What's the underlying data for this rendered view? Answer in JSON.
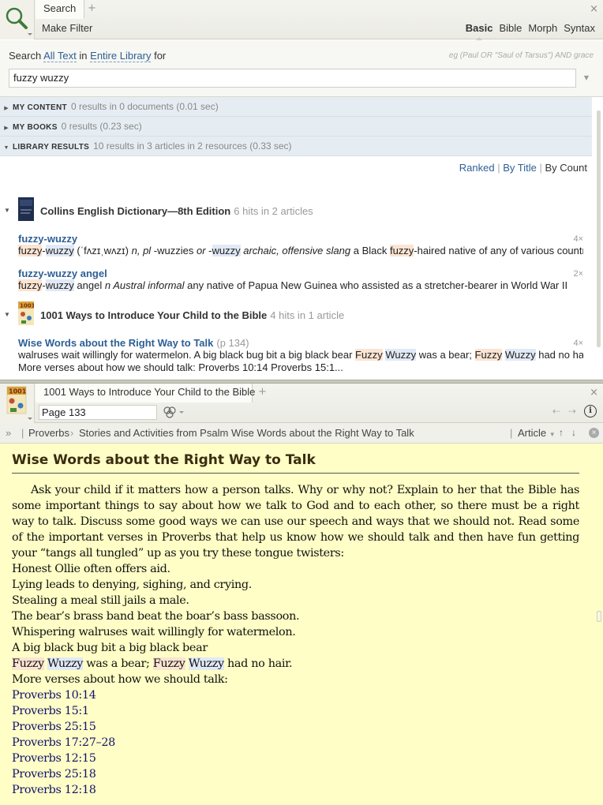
{
  "search_panel": {
    "tab_label": "Search",
    "make_filter": "Make Filter",
    "modes": [
      "Basic",
      "Bible",
      "Morph",
      "Syntax"
    ],
    "active_mode": "Basic",
    "search_line": {
      "prefix": "Search",
      "scope": "All Text",
      "in": "in",
      "library": "Entire Library",
      "suffix": "for"
    },
    "example": "eg (Paul OR \"Saul of Tarsus\") AND grace",
    "query": "fuzzy wuzzy",
    "sections": [
      {
        "name": "MY CONTENT",
        "summary": "0 results in 0 documents (0.01 sec)"
      },
      {
        "name": "MY BOOKS",
        "summary": "0 results (0.23 sec)"
      },
      {
        "name": "LIBRARY RESULTS",
        "summary": "10 results in 3 articles in 2 resources (0.33 sec)"
      }
    ],
    "sort": {
      "ranked": "Ranked",
      "sep": "|",
      "by_title": "By Title",
      "by_count": "By Count"
    },
    "resources": [
      {
        "title": "Collins English Dictionary—8th Edition",
        "hits": "6 hits in 2 articles",
        "cover_text": "Collins English Dictionary",
        "results": [
          {
            "title": "fuzzy-wuzzy",
            "count": "4×"
          },
          {
            "title": "fuzzy-wuzzy angel",
            "count": "2×"
          }
        ]
      },
      {
        "title": "1001 Ways to Introduce Your Child to the Bible",
        "hits": "4 hits in 1 article",
        "cover_text": "1001",
        "results": [
          {
            "title": "Wise Words about the Right Way to Talk",
            "page": "(p 134)",
            "count": "4×"
          }
        ]
      }
    ],
    "snippets": {
      "s1": {
        "w1": "fuzzy",
        "d1": "-",
        "w2": "wuzzy",
        "p1": " (ˈfʌzɪˌwʌzɪ) ",
        "p2": "n, pl",
        "p3": " -wuzzies ",
        "p4": "or",
        "p5": " -",
        "w3": "wuzzy",
        "p6": " ",
        "p7": "archaic, offensive slang",
        "p8": " a Black ",
        "w4": "fuzzy",
        "p9": "-haired native of any of various countries"
      },
      "s2": {
        "w1": "fuzzy",
        "d1": "-",
        "w2": "wuzzy",
        "p1": " angel ",
        "p2": "n Austral informal",
        "p3": " any native of Papua New Guinea who assisted as a stretcher-bearer in World War II"
      },
      "s3": {
        "p1": "walruses wait willingly for watermelon. A big black bug bit a big black bear ",
        "w1": "Fuzzy",
        "sp": " ",
        "w2": "Wuzzy",
        "p2": " was a bear; ",
        "w3": "Fuzzy",
        "sp2": " ",
        "w4": "Wuzzy",
        "p3": " had no hair.",
        "line2": "More verses about how we should talk: Proverbs 10:14 Proverbs 15:1..."
      }
    }
  },
  "book_panel": {
    "tab_label": "1001 Ways to Introduce Your Child to the Bible",
    "page": "Page 133",
    "breadcrumbs": [
      "Proverbs",
      "Stories and Activities from Psalm",
      "Wise Words about the Right Way to Talk"
    ],
    "article_menu": "Article",
    "article": {
      "title": "Wise Words about the Right Way to Talk",
      "paragraph": "Ask your child if it matters how a person talks. Why or why not? Explain to her that the Bible has some important things to say about how we talk to God and to each other, so there must be a right way to talk. Discuss some good ways we can use our speech and ways that we should not. Read some of the important verses in Proverbs that help us know how we should talk and then have fun getting your “tangs all tungled” up as you try these tongue twisters:",
      "lines": [
        "Honest Ollie often offers aid.",
        "Lying leads to denying, sighing, and crying.",
        "Stealing a meal still jails a male.",
        "The bear’s brass band beat the boar’s bass bassoon.",
        "Whispering walruses wait willingly for watermelon.",
        "A big black bug bit a big black bear"
      ],
      "fuzzy_line": {
        "w1": "Fuzzy",
        "w2": "Wuzzy",
        "mid": " was a bear; ",
        "w3": "Fuzzy",
        "w4": "Wuzzy",
        "end": " had no hair."
      },
      "more_line": "More verses about how we should talk:",
      "refs": [
        "Proverbs 10:14",
        "Proverbs 15:1",
        "Proverbs 25:15",
        "Proverbs 17:27–28",
        "Proverbs 12:15",
        "Proverbs 25:18",
        "Proverbs 12:18"
      ]
    }
  },
  "colors": {
    "link": "#2d5f95",
    "reading_background": "#fffec6",
    "highlight_fuzzy": "#fbe4d2",
    "highlight_wuzzy": "#e1e9f6",
    "section_header": "#e6edf2"
  }
}
